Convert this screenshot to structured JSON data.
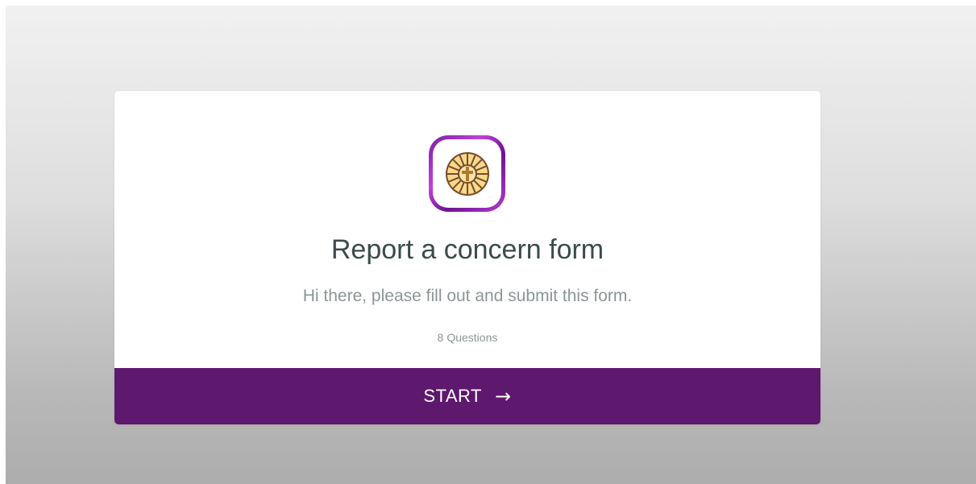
{
  "form": {
    "title": "Report a concern form",
    "subtitle": "Hi there, please fill out and submit this form.",
    "question_count": "8 Questions",
    "start_label": "START",
    "start_arrow": "→",
    "logo_icon": "stained-glass-cross-icon"
  },
  "colors": {
    "button_bg": "#5e186d",
    "logo_border": "#9b2fc0"
  }
}
